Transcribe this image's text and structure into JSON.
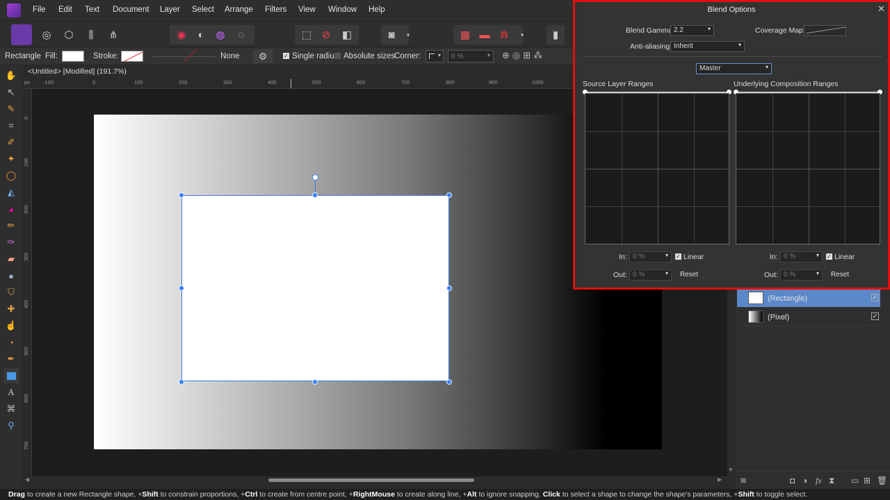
{
  "menu": [
    "File",
    "Edit",
    "Text",
    "Document",
    "Layer",
    "Select",
    "Arrange",
    "Filters",
    "View",
    "Window",
    "Help"
  ],
  "context": {
    "tool_name": "Rectangle",
    "fill_label": "Fill:",
    "stroke_label": "Stroke:",
    "stroke_style": "None",
    "single_radius": "Single radius",
    "absolute_sizes": "Absolute sizes",
    "corner_label": "Corner:",
    "corner_value": "0 %"
  },
  "document": {
    "title": "<Untitled> [Modified] (191.7%)",
    "ruler_unit": "px",
    "ruler_h": [
      "-100",
      "0",
      "100",
      "200",
      "300",
      "400",
      "500",
      "600",
      "700",
      "800",
      "900",
      "1000"
    ],
    "ruler_v": [
      "0",
      "100",
      "200",
      "300",
      "400",
      "500",
      "600",
      "700"
    ]
  },
  "dialog": {
    "title": "Blend Options",
    "blend_gamma_label": "Blend Gamma:",
    "blend_gamma_value": "2.2",
    "coverage_map_label": "Coverage Map:",
    "antialiasing_label": "Anti-aliasing:",
    "antialiasing_value": "Inherit",
    "channel_value": "Master",
    "source_title": "Source Layer Ranges",
    "underlying_title": "Underlying Composition Ranges",
    "in_label": "In:",
    "out_label": "Out:",
    "source_in": "0 %",
    "source_out": "0 %",
    "under_in": "0 %",
    "under_out": "0 %",
    "linear_label": "Linear",
    "reset_label": "Reset"
  },
  "layers": [
    {
      "name": "(Rectangle)",
      "selected": true
    },
    {
      "name": "(Pixel)",
      "selected": false
    }
  ],
  "status": {
    "s1": "Drag",
    "s2": " to create a new Rectangle shape, +",
    "s3": "Shift",
    "s4": " to constrain proportions, +",
    "s5": "Ctrl",
    "s6": " to create from centre point, +",
    "s7": "RightMouse",
    "s8": " to create along line, +",
    "s9": "Alt",
    "s10": " to ignore snapping. ",
    "s11": "Click",
    "s12": " to select a shape to change the shape's parameters, +",
    "s13": "Shift",
    "s14": " to toggle select."
  },
  "colors": {
    "accent": "#3b82f6",
    "highlight": "#e01010",
    "selected_layer": "#5b88c9"
  }
}
